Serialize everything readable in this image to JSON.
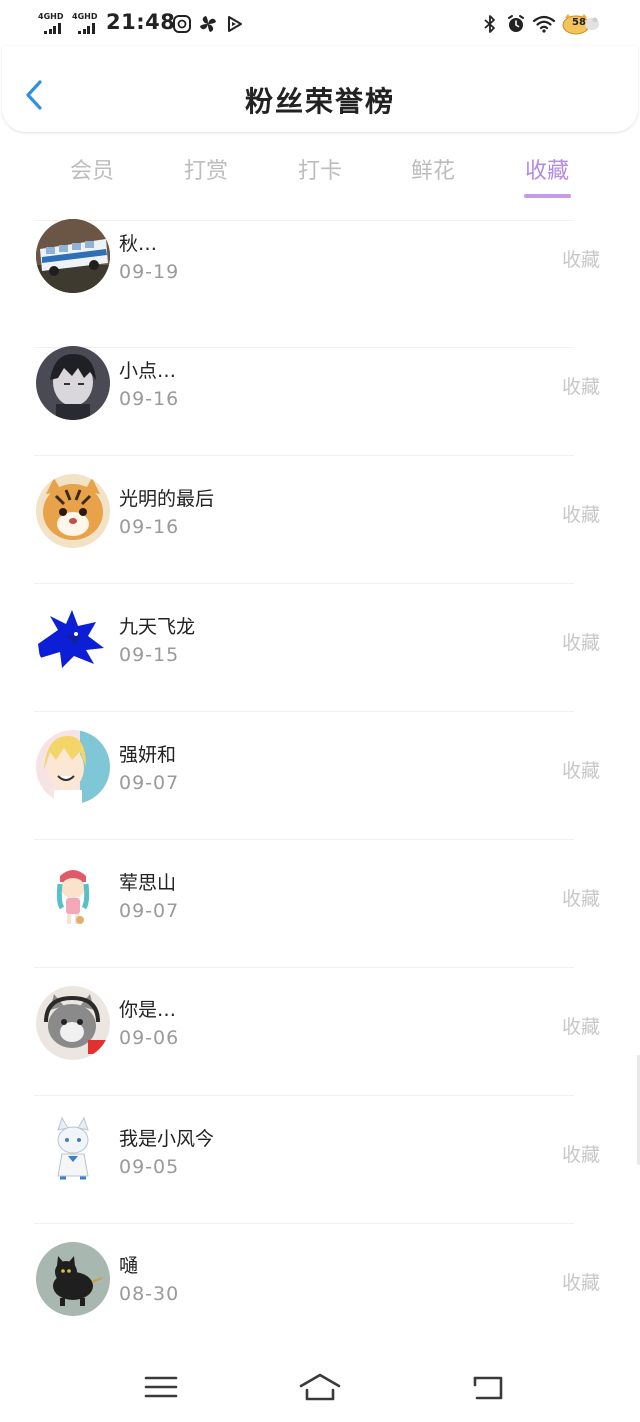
{
  "status_bar": {
    "net1": "4GHD",
    "net2": "4GHD",
    "time": "21:48",
    "battery": "58"
  },
  "header": {
    "title": "粉丝荣誉榜"
  },
  "tabs": [
    {
      "label": "会员",
      "active": false
    },
    {
      "label": "打赏",
      "active": false
    },
    {
      "label": "打卡",
      "active": false
    },
    {
      "label": "鲜花",
      "active": false
    },
    {
      "label": "收藏",
      "active": true
    }
  ],
  "list": {
    "action_label": "收藏",
    "items": [
      {
        "name": "秋…",
        "date": "09-19"
      },
      {
        "name": "小点…",
        "date": "09-16"
      },
      {
        "name": "光明的最后",
        "date": "09-16"
      },
      {
        "name": "九天飞龙",
        "date": "09-15"
      },
      {
        "name": "强妍和",
        "date": "09-07"
      },
      {
        "name": "荤思山",
        "date": "09-07"
      },
      {
        "name": "你是…",
        "date": "09-06"
      },
      {
        "name": "我是小风今",
        "date": "09-05"
      },
      {
        "name": "嗵",
        "date": "08-30"
      }
    ]
  },
  "colors": {
    "accent": "#b58ce0",
    "back_arrow": "#2f8fe0",
    "inactive_tab": "#bdbdbd",
    "action_text": "#c8c8c8"
  }
}
